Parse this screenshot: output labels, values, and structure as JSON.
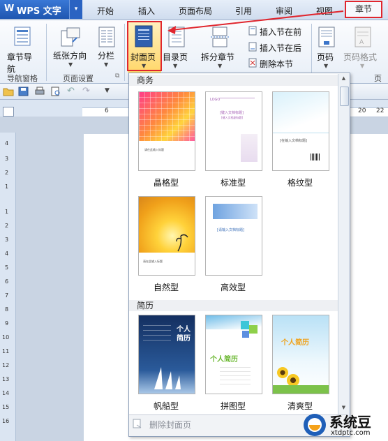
{
  "app": {
    "logo": "W",
    "title": "WPS 文字",
    "menu_arrow": "▾"
  },
  "tabs": [
    "开始",
    "插入",
    "页面布局",
    "引用",
    "审阅",
    "视图",
    "章节"
  ],
  "ribbon": {
    "chapter_nav": "章节导航",
    "orientation": "纸张方向",
    "columns": "分栏",
    "cover_page": "封面页",
    "toc_page": "目录页",
    "split_chapter": "拆分章节",
    "insert_section_before": "插入节在前",
    "insert_section_after": "插入节在后",
    "delete_section": "删除本节",
    "page_number": "页码",
    "page_number_format": "页码格式",
    "page_cut": "页",
    "group_nav": "导航窗格",
    "group_page_setup": "页面设置",
    "group_page_cut": "页"
  },
  "ruler": {
    "h_marks": [
      "6",
      "20",
      "22"
    ],
    "v_marks": [
      "4",
      "3",
      "2",
      "1",
      "1",
      "2",
      "3",
      "4",
      "5",
      "6",
      "7",
      "8",
      "9",
      "10",
      "11",
      "12",
      "13",
      "14",
      "15",
      "16"
    ]
  },
  "gallery": {
    "sections": [
      {
        "title": "商务",
        "items": [
          {
            "label": "晶格型",
            "caption": "请在此输入标题"
          },
          {
            "label": "标准型",
            "logo": "LOGO",
            "caption": "[键入文档标题]",
            "sub": "[键入文档副标题]"
          },
          {
            "label": "格纹型",
            "caption": "[在输入文档标题]"
          },
          {
            "label": "自然型",
            "caption": "请在此输入标题"
          },
          {
            "label": "高效型",
            "caption": "[请输入文档标题]"
          }
        ]
      },
      {
        "title": "简历",
        "items": [
          {
            "label": "帆船型",
            "caption": "个人简历"
          },
          {
            "label": "拼图型",
            "caption": "个人简历"
          },
          {
            "label": "清爽型",
            "caption": "个人简历"
          }
        ]
      }
    ],
    "delete_cover": "删除封面页"
  },
  "watermark": {
    "text": "系统豆",
    "url": "xtdptc.com"
  },
  "colors": {
    "accent_red": "#e0262e",
    "brand_blue": "#1f56b0"
  }
}
